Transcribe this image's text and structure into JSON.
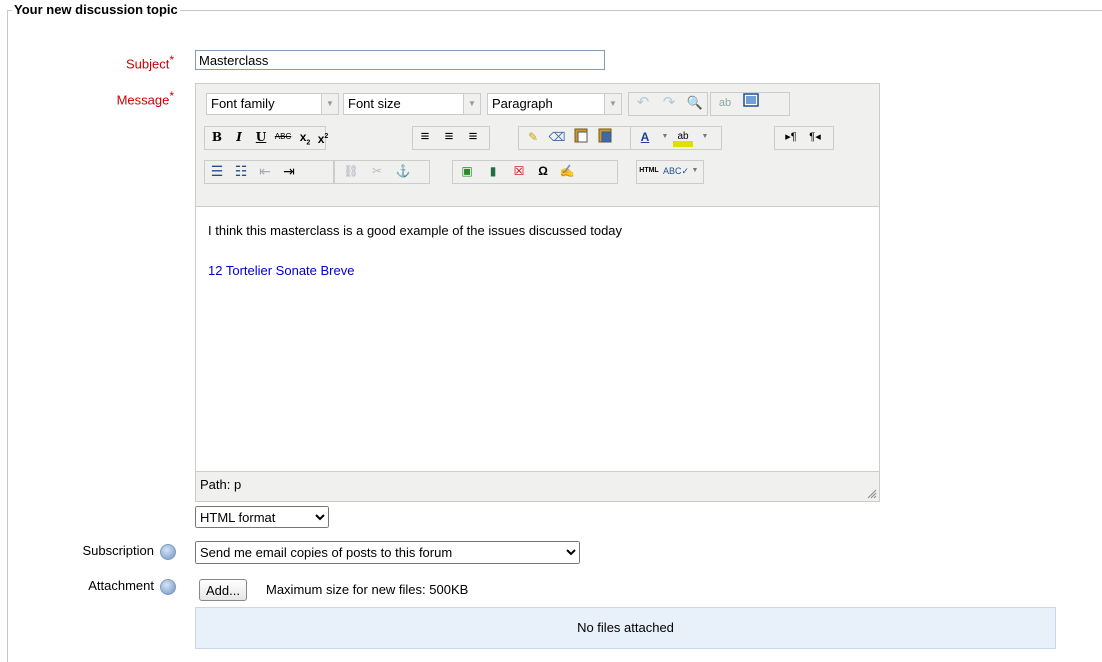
{
  "form": {
    "legend": "Your new discussion topic",
    "subject_label": "Subject",
    "subject_value": "Masterclass",
    "message_label": "Message",
    "required_mark": "*"
  },
  "editor": {
    "font_family": "Font family",
    "font_size": "Font size",
    "block_format": "Paragraph",
    "content_line1": "I think this masterclass is a good example of the issues discussed today",
    "content_link": "12 Tortelier Sonate Breve",
    "path": "Path: p",
    "colors": {
      "link": "#0000cc",
      "required": "#cc0000"
    }
  },
  "format": {
    "selected": "HTML format"
  },
  "subscription": {
    "label": "Subscription",
    "selected": "Send me email copies of posts to this forum"
  },
  "attachment": {
    "label": "Attachment",
    "add_label": "Add...",
    "max_size": "Maximum size for new files: 500KB",
    "no_files": "No files attached"
  }
}
